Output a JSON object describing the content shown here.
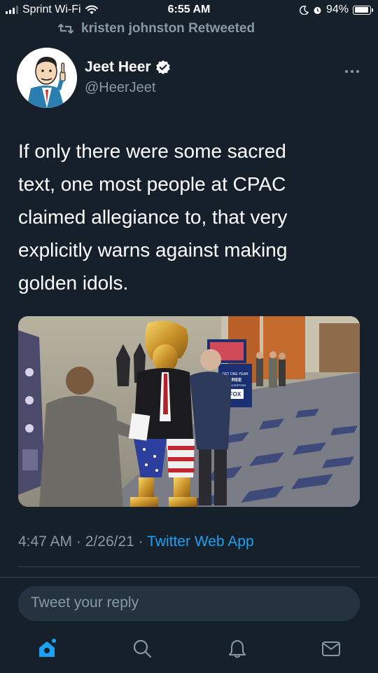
{
  "status_bar": {
    "carrier": "Sprint Wi-Fi",
    "time": "6:55 AM",
    "battery": "94%",
    "battery_level": 0.94
  },
  "retweet": {
    "label": "kristen johnston Retweeted"
  },
  "author": {
    "name": "Jeet Heer",
    "handle": "@HeerJeet",
    "verified": true
  },
  "tweet": {
    "text_lines": [
      "If only there were some sacred",
      "text, one most people at CPAC",
      "claimed allegiance to, that very",
      "explicitly warns against making",
      "golden idols."
    ],
    "timestamp_time": "4:47 AM",
    "timestamp_date": "2/26/21",
    "separator": "·",
    "app": "Twitter Web App"
  },
  "reply": {
    "placeholder": "Tweet your reply"
  },
  "media": {
    "sign_text": [
      "GET ONE YEAR",
      "FREE",
      "SUBSCRIPTION"
    ],
    "sign_logo": "FOX"
  },
  "tab_bar": {
    "items": [
      "home-icon",
      "search-icon",
      "notifications-icon",
      "messages-icon"
    ]
  },
  "colors": {
    "background": "#15202b",
    "secondary_text": "#8899a6",
    "accent": "#1da1f2",
    "divider": "#38444d"
  }
}
